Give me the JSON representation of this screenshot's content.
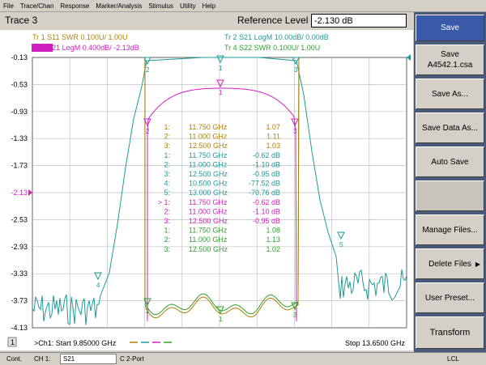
{
  "menu": [
    "File",
    "Trace/Chan",
    "Response",
    "Marker/Analysis",
    "Stimulus",
    "Utility",
    "Help"
  ],
  "title": "Trace 3",
  "ref_label": "Reference Level",
  "ref_value": "-2.130 dB",
  "traces": [
    {
      "label": "Tr  1  S11 SWR 0.100U/  1.00U",
      "color": "#b08000"
    },
    {
      "label": "Tr  2  S21 LogM 10.00dB/  0.00dB",
      "color": "#1f9a9a"
    },
    {
      "label": "Tr  3  S21 LogM 0.400dB/  -2.13dB",
      "color": "#d020c0",
      "badge": "Tr 3"
    },
    {
      "label": "Tr  4  S22 SWR 0.100U/  1.00U",
      "color": "#30a030"
    }
  ],
  "yticks": [
    "-0.13",
    "-0.53",
    "-0.93",
    "-1.33",
    "-1.73",
    "-2.13",
    "-2.53",
    "-2.93",
    "-3.33",
    "-3.73",
    "-4.13"
  ],
  "markers": [
    {
      "n": "1:",
      "f": "11.750 GHz",
      "v": "1.07",
      "c": "#b08000"
    },
    {
      "n": "2:",
      "f": "11.000 GHz",
      "v": "1.11",
      "c": "#b08000"
    },
    {
      "n": "3:",
      "f": "12.500 GHz",
      "v": "1.03",
      "c": "#b08000"
    },
    {
      "n": "1:",
      "f": "11.750 GHz",
      "v": "-0.62 dB",
      "c": "#1f9a9a"
    },
    {
      "n": "2:",
      "f": "11.000 GHz",
      "v": "-1.10 dB",
      "c": "#1f9a9a"
    },
    {
      "n": "3:",
      "f": "12.500 GHz",
      "v": "-0.95 dB",
      "c": "#1f9a9a"
    },
    {
      "n": "4:",
      "f": "10.500 GHz",
      "v": "-77.52 dB",
      "c": "#1f9a9a"
    },
    {
      "n": "5:",
      "f": "13.000 GHz",
      "v": "-70.76 dB",
      "c": "#1f9a9a"
    },
    {
      "n": "> 1:",
      "f": "11.750 GHz",
      "v": "-0.62 dB",
      "c": "#d020c0"
    },
    {
      "n": "2:",
      "f": "11.000 GHz",
      "v": "-1.10 dB",
      "c": "#d020c0"
    },
    {
      "n": "3:",
      "f": "12.500 GHz",
      "v": "-0.95 dB",
      "c": "#d020c0"
    },
    {
      "n": "1:",
      "f": "11.750 GHz",
      "v": "1.08",
      "c": "#30a030"
    },
    {
      "n": "2:",
      "f": "11.000 GHz",
      "v": "1.13",
      "c": "#30a030"
    },
    {
      "n": "3:",
      "f": "12.500 GHz",
      "v": "1.02",
      "c": "#30a030"
    }
  ],
  "channel_index": "1",
  "start_label": ">Ch1: Start  9.85000 GHz",
  "stop_label": "Stop  13.6500 GHz",
  "softkeys": [
    "Save",
    "Save\nA4542.1.csa",
    "Save As...",
    "Save Data As...",
    "Auto Save",
    "",
    "Manage Files...",
    "Delete Files",
    "User Preset...",
    "Transform"
  ],
  "status": {
    "left": "Cont.",
    "ch": "CH 1:",
    "param": "S21",
    "port": "C  2-Port",
    "right": "LCL"
  },
  "colors": {
    "tr1": "#b08000",
    "tr2": "#1f9a9a",
    "tr3": "#d020c0",
    "tr4": "#30a030",
    "softkey_active": "#3a5aa8",
    "panel": "#4a5a7a"
  }
}
